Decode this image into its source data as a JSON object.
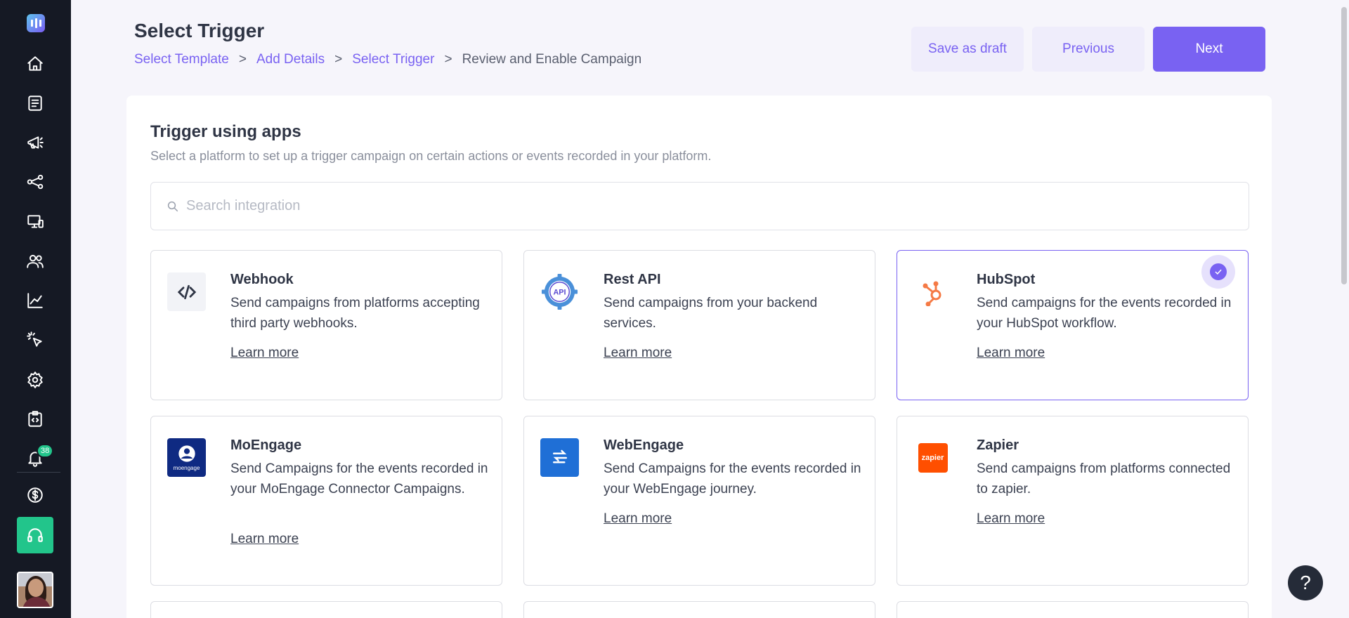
{
  "sidebar": {
    "items": [
      {
        "name": "home-icon"
      },
      {
        "name": "document-icon"
      },
      {
        "name": "megaphone-icon"
      },
      {
        "name": "share-nodes-icon"
      },
      {
        "name": "monitor-icon"
      },
      {
        "name": "users-icon"
      },
      {
        "name": "chart-icon"
      },
      {
        "name": "cursor-click-icon"
      },
      {
        "name": "gear-icon"
      },
      {
        "name": "clipboard-code-icon"
      },
      {
        "name": "bell-icon"
      },
      {
        "name": "dollar-icon"
      }
    ],
    "notification_count": "38"
  },
  "header": {
    "title": "Select Trigger",
    "breadcrumb": [
      "Select Template",
      "Add Details",
      "Select Trigger",
      "Review and Enable Campaign"
    ],
    "separator": ">",
    "save_draft": "Save as draft",
    "previous": "Previous",
    "next": "Next"
  },
  "main": {
    "section_title": "Trigger using apps",
    "section_desc": "Select a platform to set up a trigger campaign on certain actions or events recorded in your platform.",
    "search_placeholder": "Search integration",
    "learn_more": "Learn more",
    "integrations": [
      {
        "name": "Webhook",
        "desc": "Send campaigns from platforms accepting third party webhooks.",
        "icon": "code-icon",
        "selected": false
      },
      {
        "name": "Rest API",
        "desc": "Send campaigns from your backend services.",
        "icon": "api-gear-icon",
        "selected": false
      },
      {
        "name": "HubSpot",
        "desc": "Send campaigns for the events recorded in your HubSpot workflow.",
        "icon": "hubspot-icon",
        "selected": true
      },
      {
        "name": "MoEngage",
        "desc": "Send Campaigns for the events recorded in your MoEngage Connector Campaigns.",
        "icon": "moengage-icon",
        "selected": false
      },
      {
        "name": "WebEngage",
        "desc": "Send Campaigns for the events recorded in your WebEngage journey.",
        "icon": "webengage-icon",
        "selected": false
      },
      {
        "name": "Zapier",
        "desc": "Send campaigns from platforms connected to zapier.",
        "icon": "zapier-icon",
        "selected": false
      }
    ],
    "moengage_logo_text": "moengage",
    "zapier_logo_text": "zapier",
    "api_logo_text": "API"
  },
  "help": "?",
  "colors": {
    "accent": "#7962f2",
    "sidebar": "#151924",
    "success": "#22c58b"
  }
}
